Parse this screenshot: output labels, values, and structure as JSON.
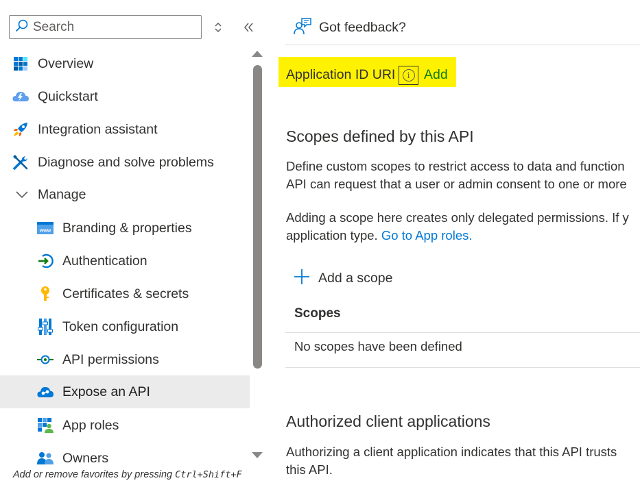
{
  "search": {
    "placeholder": "Search"
  },
  "nav": {
    "items": [
      {
        "label": "Overview",
        "icon": "grid-icon"
      },
      {
        "label": "Quickstart",
        "icon": "cloud-bolt-icon"
      },
      {
        "label": "Integration assistant",
        "icon": "rocket-icon"
      },
      {
        "label": "Diagnose and solve problems",
        "icon": "wrench-icon"
      },
      {
        "label": "Manage",
        "icon": "chevron-down-icon"
      },
      {
        "label": "Branding & properties",
        "icon": "www-icon"
      },
      {
        "label": "Authentication",
        "icon": "signin-icon"
      },
      {
        "label": "Certificates & secrets",
        "icon": "key-icon"
      },
      {
        "label": "Token configuration",
        "icon": "token-bars-icon"
      },
      {
        "label": "API permissions",
        "icon": "api-permissions-icon"
      },
      {
        "label": "Expose an API",
        "icon": "cloud-api-icon",
        "selected": true
      },
      {
        "label": "App roles",
        "icon": "app-roles-icon"
      },
      {
        "label": "Owners",
        "icon": "people-icon"
      }
    ],
    "hint_text": "Add or remove favorites by pressing ",
    "hint_keys": "Ctrl+Shift+F"
  },
  "toolbar": {
    "feedback_label": "Got feedback?"
  },
  "app_id": {
    "label": "Application ID URI",
    "info_glyph": "i",
    "add_label": "Add",
    "highlight_color": "#fff200"
  },
  "scopes": {
    "heading": "Scopes defined by this API",
    "desc_line1": "Define custom scopes to restrict access to data and function",
    "desc_line2": "API can request that a user or admin consent to one or more",
    "note_line1": "Adding a scope here creates only delegated permissions. If y",
    "note_line2_prefix": "application type. ",
    "note_link": "Go to App roles.",
    "add_scope_label": "Add a scope",
    "table_header": "Scopes",
    "empty_text": "No scopes have been defined"
  },
  "clients": {
    "heading": "Authorized client applications",
    "desc_line1": "Authorizing a client application indicates that this API trusts",
    "desc_line2": "this API."
  },
  "colors": {
    "accent": "#0078d4",
    "add_link": "#107c10",
    "selected_bg": "#ebebeb"
  }
}
